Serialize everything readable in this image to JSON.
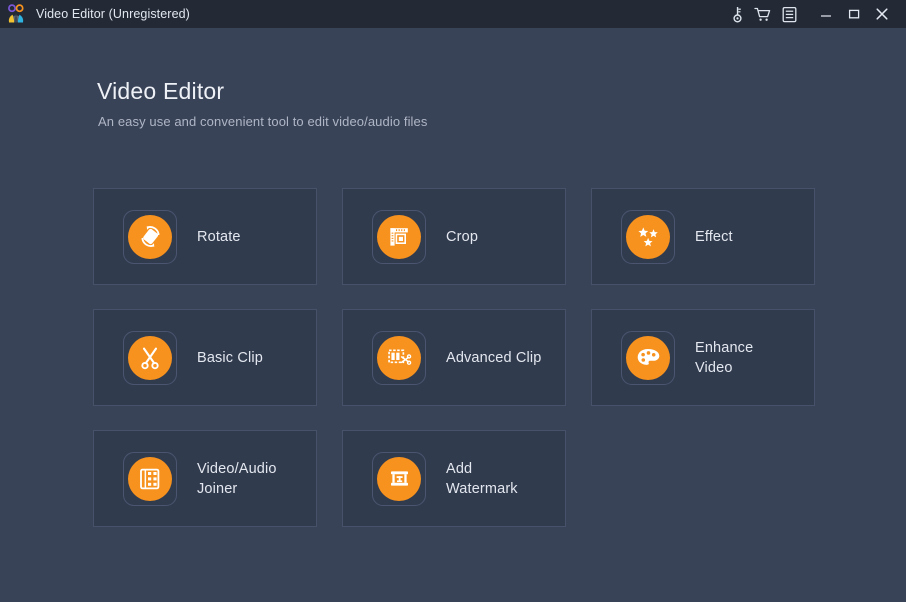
{
  "window": {
    "title": "Video Editor (Unregistered)",
    "app_icon": "people-logo-icon",
    "toolbar_buttons": [
      {
        "name": "register-key-icon",
        "label": "Register"
      },
      {
        "name": "shopping-cart-icon",
        "label": "Buy"
      },
      {
        "name": "menu-list-icon",
        "label": "Menu"
      }
    ],
    "controls": [
      {
        "name": "minimize-button",
        "label": "Minimize"
      },
      {
        "name": "maximize-button",
        "label": "Maximize"
      },
      {
        "name": "close-button",
        "label": "Close"
      }
    ]
  },
  "header": {
    "title": "Video Editor",
    "subtitle": "An easy use and convenient tool to edit video/audio files"
  },
  "colors": {
    "titlebar_bg": "#232a36",
    "page_bg": "#394357",
    "card_bg": "#313b4e",
    "card_border": "#47516a",
    "accent_orange": "#f7921e",
    "text_primary": "#e3e7ef",
    "text_secondary": "#aeb6c6"
  },
  "tools": [
    {
      "id": "rotate",
      "label": "Rotate",
      "icon": "rotate-icon"
    },
    {
      "id": "crop",
      "label": "Crop",
      "icon": "crop-icon"
    },
    {
      "id": "effect",
      "label": "Effect",
      "icon": "stars-effect-icon"
    },
    {
      "id": "basic-clip",
      "label": "Basic Clip",
      "icon": "scissors-icon"
    },
    {
      "id": "advanced-clip",
      "label": "Advanced Clip",
      "icon": "filmstrip-scissors-icon"
    },
    {
      "id": "enhance-video",
      "label": "Enhance\nVideo",
      "icon": "paint-palette-icon"
    },
    {
      "id": "video-audio-joiner",
      "label": "Video/Audio\nJoiner",
      "icon": "filmstrip-join-icon"
    },
    {
      "id": "add-watermark",
      "label": "Add\nWatermark",
      "icon": "watermark-stamp-icon"
    }
  ]
}
